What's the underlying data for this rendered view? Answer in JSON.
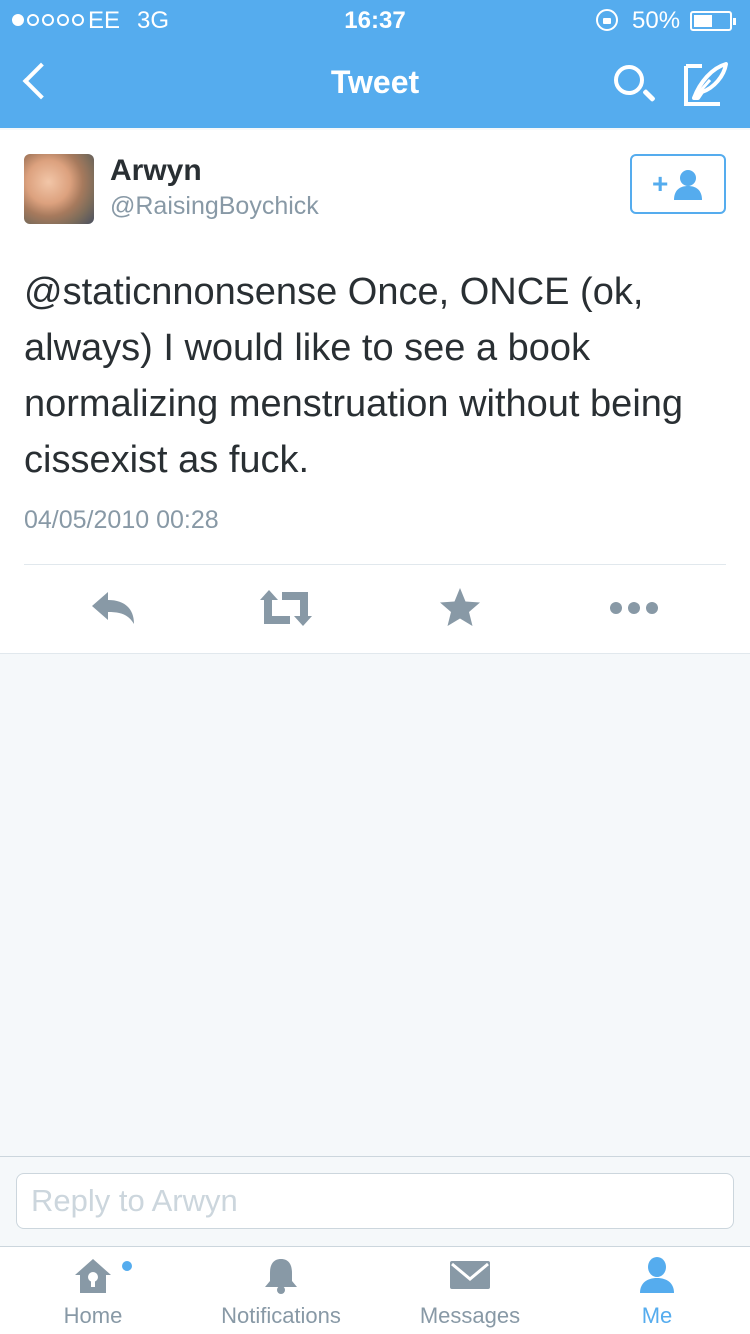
{
  "status_bar": {
    "carrier": "EE",
    "network": "3G",
    "time": "16:37",
    "battery_percent": "50%",
    "battery_level": 0.5,
    "signal_bars_filled": 1,
    "signal_bars_total": 5
  },
  "nav": {
    "title": "Tweet",
    "back_icon": "chevron-left-icon",
    "search_icon": "search-icon",
    "compose_icon": "compose-quill-icon"
  },
  "tweet": {
    "author_name": "Arwyn",
    "author_handle": "@RaisingBoychick",
    "text": "@staticnnonsense Once, ONCE (ok, always) I would like to see a book normalizing menstruation without being cissexist as fuck.",
    "timestamp": "04/05/2010 00:28",
    "follow_label": "+"
  },
  "actions": [
    {
      "name": "reply",
      "icon": "reply-icon"
    },
    {
      "name": "retweet",
      "icon": "retweet-icon"
    },
    {
      "name": "favorite",
      "icon": "star-icon"
    },
    {
      "name": "more",
      "icon": "more-icon"
    }
  ],
  "reply": {
    "placeholder": "Reply to Arwyn"
  },
  "tabs": [
    {
      "label": "Home",
      "icon": "home-icon",
      "has_dot": true
    },
    {
      "label": "Notifications",
      "icon": "bell-icon",
      "has_dot": false
    },
    {
      "label": "Messages",
      "icon": "envelope-icon",
      "has_dot": false
    },
    {
      "label": "Me",
      "icon": "person-icon",
      "active": true
    }
  ],
  "colors": {
    "brand": "#55acee",
    "text": "#292f33",
    "muted": "#8899a6",
    "icon_gray": "#8899a6",
    "background": "#f5f8fa"
  }
}
